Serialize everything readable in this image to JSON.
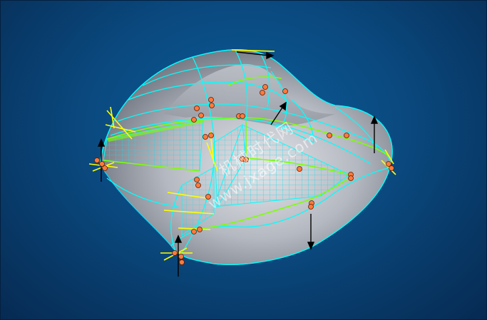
{
  "watermark": {
    "chinese": "机械时代网",
    "url": "www.jxage.com"
  },
  "colors": {
    "background": "#0a4a80",
    "wireframe": "#00ffff",
    "edge_highlight": "#7dff00",
    "handle": "#ffff00",
    "point": "#ff7a3c",
    "surface": "#b8bcc4"
  },
  "icons": {
    "point_marker": "circle",
    "direction_arrow": "arrow"
  }
}
